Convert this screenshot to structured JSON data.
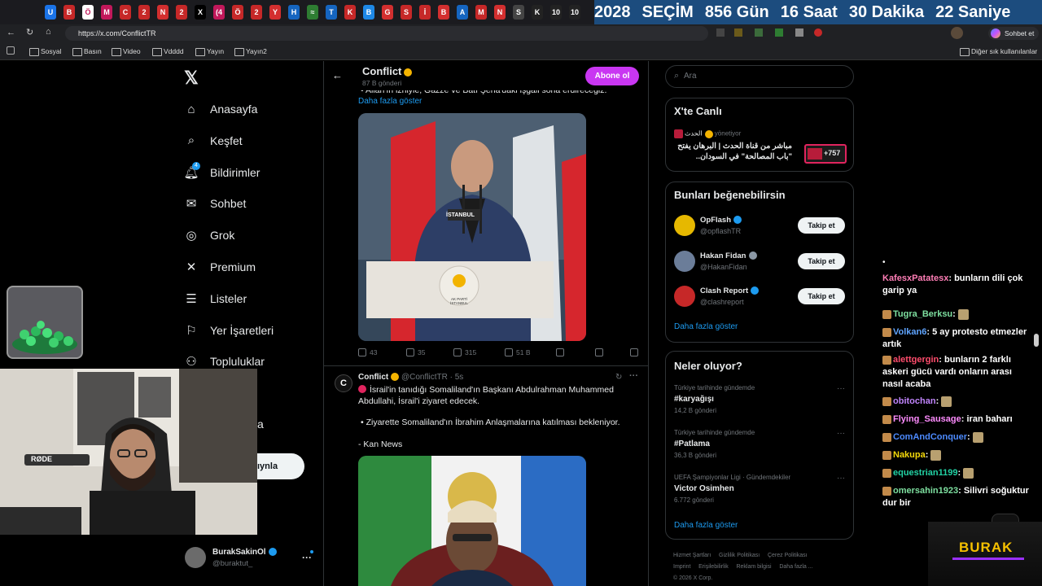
{
  "browser": {
    "tabs": [
      "U",
      "B",
      "Ö",
      "M",
      "C",
      "2",
      "N",
      "2",
      "X",
      "(4",
      "Ö",
      "2",
      "Y",
      "H",
      "≈",
      "T",
      "K",
      "B",
      "G",
      "S",
      "İ",
      "B",
      "A",
      "M",
      "N",
      "S",
      "K",
      "10",
      "10"
    ],
    "countdown": {
      "year": "2028",
      "word": "SEÇİM",
      "days": "856 Gün",
      "hours": "16 Saat",
      "minutes": "30 Dakika",
      "seconds": "22 Saniye"
    },
    "url": "https://x.com/ConflictTR",
    "chat_label": "Sohbet et",
    "bookmarks": [
      "Sosyal",
      "Basın",
      "Video",
      "Vdddd",
      "Yayın",
      "Yayın2"
    ],
    "other_bookmarks": "Diğer sık kullanılanlar"
  },
  "nav": {
    "items": [
      {
        "label": "Anasayfa",
        "icon": "home-icon"
      },
      {
        "label": "Keşfet",
        "icon": "search-icon"
      },
      {
        "label": "Bildirimler",
        "icon": "bell-icon",
        "badge": "4"
      },
      {
        "label": "Sohbet",
        "icon": "mail-icon"
      },
      {
        "label": "Grok",
        "icon": "grok-icon"
      },
      {
        "label": "Premium",
        "icon": "x-icon"
      },
      {
        "label": "Listeler",
        "icon": "list-icon"
      },
      {
        "label": "Yer İşaretleri",
        "icon": "bookmark-icon"
      },
      {
        "label": "Topluluklar",
        "icon": "people-icon"
      }
    ],
    "partial_label": "a",
    "post_button_partial": "ıynla",
    "account": {
      "name": "BurakSakinOl",
      "handle": "@buraktut_"
    }
  },
  "profile_header": {
    "name": "Conflict",
    "posts": "87 B gönderi",
    "subscribe": "Abone ol"
  },
  "post1": {
    "text_tail": "Allah'ın izniyle, Gazze ve Batı Şeria'daki işgali sona erdireceğiz.",
    "show_more": "Daha fazla göster",
    "podium_text": "AK PARTİ İSTANBUL",
    "mic_text": "İSTANBUL",
    "replies": "43",
    "reposts": "35",
    "likes": "315",
    "views": "51 B"
  },
  "post2": {
    "name": "Conflict",
    "handle": "@ConflictTR",
    "time": "5s",
    "line1": "İsrail'in tanıdığı Somaliland'ın Başkanı Abdulrahman Muhammed Abdullahi, İsrail'i ziyaret edecek.",
    "bullet": "Ziyarette Somaliland'ın İbrahim Anlaşmalarına katılması bekleniyor.",
    "source": "- Kan News"
  },
  "search": {
    "placeholder": "Ara"
  },
  "live": {
    "title": "X'te Canlı",
    "host": "الحدث",
    "host_role": "yönetiyor",
    "text": "مباشر من قناة الحدث | البرهان يفتح \"باب المصالحة\" في السودان..",
    "count": "+757"
  },
  "suggestions": {
    "title": "Bunları beğenebilirsin",
    "items": [
      {
        "name": "OpFlash",
        "handle": "@opflashTR",
        "button": "Takip et"
      },
      {
        "name": "Hakan Fidan",
        "handle": "@HakanFidan",
        "button": "Takip et"
      },
      {
        "name": "Clash Report",
        "handle": "@clashreport",
        "button": "Takip et"
      }
    ],
    "more": "Daha fazla göster"
  },
  "trends": {
    "title": "Neler oluyor?",
    "items": [
      {
        "context": "Türkiye tarihinde gündemde",
        "title": "#karyağışı",
        "count": "14,2 B gönderi"
      },
      {
        "context": "Türkiye tarihinde gündemde",
        "title": "#Patlama",
        "count": "36,3 B gönderi"
      },
      {
        "context": "UEFA Şampiyonlar Ligi · Gündemdekiler",
        "title": "Victor Osimhen",
        "count": "6.772 gönderi"
      }
    ],
    "more": "Daha fazla göster"
  },
  "footer": {
    "links": [
      "Hizmet Şartları",
      "Gizlilik Politikası",
      "Çerez Politikası",
      "Imprint",
      "Erişilebilirlik",
      "Reklam bilgisi",
      "Daha fazla ..."
    ],
    "copyright": "© 2026 X Corp."
  },
  "chat": [
    {
      "user": "KafesxPatatesx",
      "msg": "bunların dili çok garip ya",
      "color": "#ff7eb6"
    },
    {
      "user": "Tugra_Berksu",
      "msg": "",
      "color": "#7ee0a0"
    },
    {
      "user": "Volkan6",
      "msg": "5 ay protesto etmezler artık",
      "color": "#60a5ff"
    },
    {
      "user": "alettgergin",
      "msg": "bunların 2 farklı askeri gücü vardı onların arası nasıl acaba",
      "color": "#ff4d6d"
    },
    {
      "user": "obitochan",
      "msg": "",
      "color": "#c084fc"
    },
    {
      "user": "Flying_Sausage",
      "msg": "iran baharı",
      "color": "#ff8cff"
    },
    {
      "user": "ComAndConquer",
      "msg": "",
      "color": "#4d8bff"
    },
    {
      "user": "Nakupa",
      "msg": "",
      "color": "#f5d90a"
    },
    {
      "user": "equestrian1199",
      "msg": "",
      "color": "#22d3a5"
    },
    {
      "user": "omersahin1923",
      "msg": "Silivri soğuktur dur bir",
      "color": "#7ee0a0"
    }
  ],
  "overlay": {
    "streamer_logo": "BURAK",
    "mic_brand": "RØDE"
  }
}
